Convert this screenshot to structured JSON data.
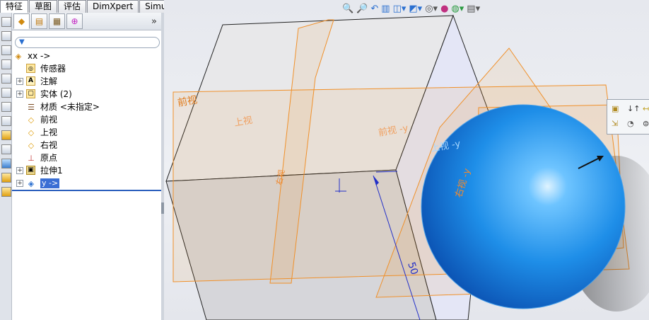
{
  "command_tabs": [
    {
      "label": "特征",
      "active": true
    },
    {
      "label": "草图",
      "active": false
    },
    {
      "label": "评估",
      "active": false
    },
    {
      "label": "DimXpert",
      "active": false
    },
    {
      "label": "Simulation",
      "active": false
    }
  ],
  "panel": {
    "tab_icons": [
      "feature-manager-icon",
      "property-manager-icon",
      "configuration-manager-icon",
      "dimxpert-manager-icon"
    ],
    "expand_glyph": "»",
    "filter_icon": "filter-icon"
  },
  "tree": {
    "root": {
      "label": "xx ->",
      "icon": "part-icon"
    },
    "items": [
      {
        "label": "传感器",
        "icon": "sensor-icon",
        "expandable": false
      },
      {
        "label": "注解",
        "icon": "annotation-icon",
        "expandable": true
      },
      {
        "label": "实体 (2)",
        "icon": "solid-bodies-icon",
        "expandable": true
      },
      {
        "label": "材质 <未指定>",
        "icon": "material-icon",
        "expandable": false
      },
      {
        "label": "前视",
        "icon": "plane-icon",
        "expandable": false
      },
      {
        "label": "上视",
        "icon": "plane-icon",
        "expandable": false
      },
      {
        "label": "右视",
        "icon": "plane-icon",
        "expandable": false
      },
      {
        "label": "原点",
        "icon": "origin-icon",
        "expandable": false
      },
      {
        "label": "拉伸1",
        "icon": "extrude-icon",
        "expandable": true
      },
      {
        "label": "y ->",
        "icon": "part-reference-icon",
        "expandable": true,
        "selected": true
      }
    ]
  },
  "viewport": {
    "plane_labels": {
      "front": "前视",
      "top": "上视",
      "front_y": "前视 -y",
      "top_y": "上视 -y",
      "right": "右视",
      "right_y": "右视 -y"
    },
    "dimension": "50",
    "hud_icons": [
      "zoom-to-fit-icon",
      "zoom-area-icon",
      "previous-view-icon",
      "section-view-icon",
      "view-orientation-icon",
      "display-style-icon",
      "hide-show-icon",
      "appearance-icon",
      "scene-icon",
      "view-settings-icon"
    ]
  },
  "colors": {
    "plane": "#f0902a",
    "sphere": "#2d8fe8",
    "selection": "#3a6ed4",
    "dimension": "#2330c8"
  }
}
